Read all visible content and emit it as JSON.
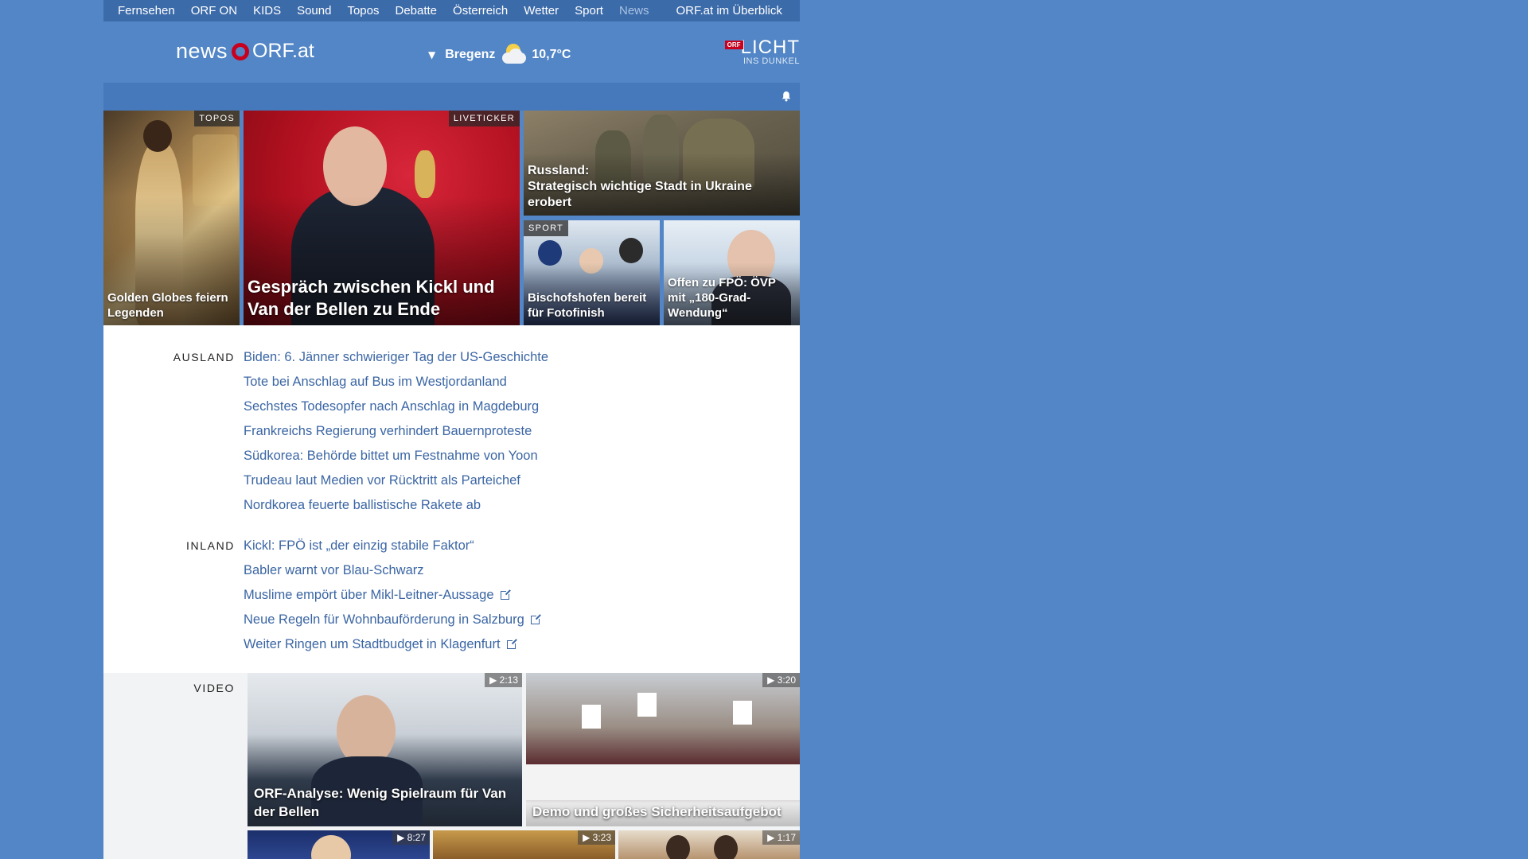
{
  "nav": {
    "items": [
      "Fernsehen",
      "ORF ON",
      "KIDS",
      "Sound",
      "Topos",
      "Debatte",
      "Österreich",
      "Wetter",
      "Sport",
      "News"
    ],
    "active": "News",
    "overview": "ORF.at im Überblick"
  },
  "header": {
    "logo_news": "news",
    "logo_orf": "ORF.at",
    "weather": {
      "city": "Bregenz",
      "temp": "10,7°C",
      "icon": "partly-cloudy-icon"
    },
    "campaign": {
      "badge": "ORF",
      "line1": "LICHT",
      "line2": "INS DUNKEL"
    }
  },
  "hero": {
    "t1": {
      "tag": "TOPOS",
      "caption": "Golden Globes feiern Legenden"
    },
    "t2": {
      "tag": "LIVETICKER",
      "caption": "Gespräch zwischen Kickl und Van der Bellen zu Ende"
    },
    "t3": {
      "caption_line1": "Russland:",
      "caption_line2": "Strategisch wichtige Stadt in Ukraine erobert"
    },
    "t4": {
      "tag": "SPORT",
      "caption": "Bischofshofen bereit für Fotofinish"
    },
    "t5": {
      "caption": "Offen zu FPÖ: ÖVP mit „180-Grad-Wendung“"
    }
  },
  "ausland": {
    "label": "AUSLAND",
    "items": [
      "Biden: 6. Jänner schwieriger Tag der US-Geschichte",
      "Tote bei Anschlag auf Bus im Westjordanland",
      "Sechstes Todesopfer nach Anschlag in Magdeburg",
      "Frankreichs Regierung verhindert Bauernproteste",
      "Südkorea: Behörde bittet um Festnahme von Yoon",
      "Trudeau laut Medien vor Rücktritt als Parteichef",
      "Nordkorea feuerte ballistische Rakete ab"
    ]
  },
  "inland": {
    "label": "INLAND",
    "items": [
      "Kickl: FPÖ ist „der einzig stabile Faktor“",
      "Babler warnt vor Blau-Schwarz",
      "Muslime empört über Mikl-Leitner-Aussage",
      "Neue Regeln für Wohnbauförderung in Salzburg",
      "Weiter Ringen um Stadtbudget in Klagenfurt"
    ]
  },
  "video": {
    "label": "VIDEO",
    "v1": {
      "duration": "2:13",
      "caption": "ORF-Analyse: Wenig Spielraum für Van der Bellen"
    },
    "v2": {
      "duration": "3:20",
      "caption": "Demo und großes Sicherheitsaufgebot"
    },
    "v3": {
      "duration": "8:27"
    },
    "v4": {
      "duration": "3:23"
    },
    "v5": {
      "duration": "1:17"
    }
  },
  "colors": {
    "page_bg": "#5286c6",
    "link": "#3b66a4",
    "orf_red": "#c8001e"
  }
}
